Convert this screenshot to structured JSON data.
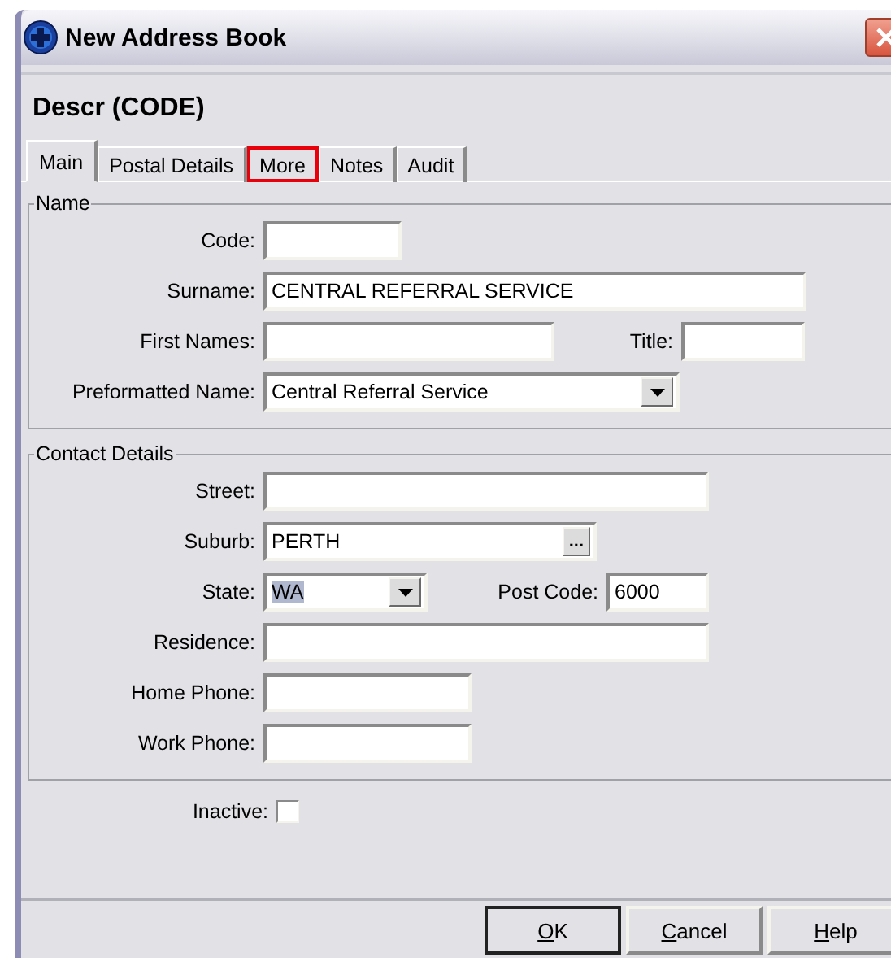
{
  "window": {
    "title": "New Address Book"
  },
  "header": "Descr (CODE)",
  "tabs": [
    {
      "label": "Main",
      "selected": true,
      "highlighted": false
    },
    {
      "label": "Postal Details",
      "selected": false,
      "highlighted": false
    },
    {
      "label": "More",
      "selected": false,
      "highlighted": true
    },
    {
      "label": "Notes",
      "selected": false,
      "highlighted": false
    },
    {
      "label": "Audit",
      "selected": false,
      "highlighted": false
    }
  ],
  "name_group": {
    "legend": "Name",
    "code": {
      "label": "Code:"
    },
    "surname": {
      "label": "Surname:",
      "value": "CENTRAL REFERRAL SERVICE"
    },
    "first_names": {
      "label": "First Names:"
    },
    "title": {
      "label": "Title:"
    },
    "preformatted_name": {
      "label": "Preformatted Name:",
      "value": "Central Referral Service"
    }
  },
  "contact_group": {
    "legend": "Contact Details",
    "street": {
      "label": "Street:"
    },
    "suburb": {
      "label": "Suburb:",
      "value": "PERTH",
      "button": "..."
    },
    "state": {
      "label": "State:",
      "value": "WA",
      "selected": true
    },
    "post_code": {
      "label": "Post Code:",
      "value": "6000"
    },
    "residence": {
      "label": "Residence:"
    },
    "home_phone": {
      "label": "Home Phone:"
    },
    "work_phone": {
      "label": "Work Phone:"
    }
  },
  "inactive": {
    "label": "Inactive:",
    "checked": false
  },
  "buttons": [
    {
      "label": "OK",
      "default": true
    },
    {
      "label": "Cancel",
      "default": false
    },
    {
      "label": "Help",
      "default": false
    }
  ]
}
